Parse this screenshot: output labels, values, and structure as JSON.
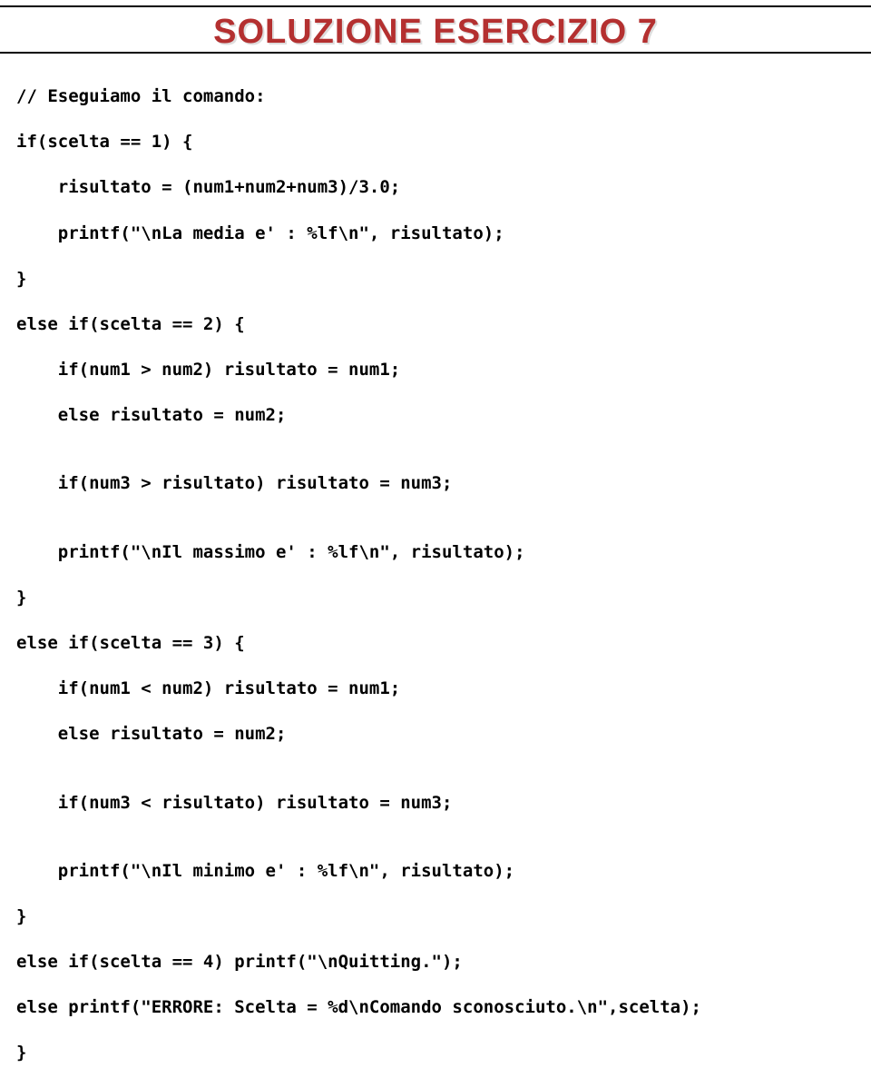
{
  "title": "SOLUZIONE ESERCIZIO 7",
  "code": {
    "l1": "// Eseguiamo il comando:",
    "l2": "if(scelta == 1) {",
    "l3": "    risultato = (num1+num2+num3)/3.0;",
    "l4": "    printf(\"\\nLa media e' : %lf\\n\", risultato);",
    "l5": "}",
    "l6": "else if(scelta == 2) {",
    "l7": "    if(num1 > num2) risultato = num1;",
    "l8": "    else risultato = num2;",
    "l9": "",
    "l10": "    if(num3 > risultato) risultato = num3;",
    "l11": "",
    "l12": "    printf(\"\\nIl massimo e' : %lf\\n\", risultato);",
    "l13": "}",
    "l14": "else if(scelta == 3) {",
    "l15": "    if(num1 < num2) risultato = num1;",
    "l16": "    else risultato = num2;",
    "l17": "",
    "l18": "    if(num3 < risultato) risultato = num3;",
    "l19": "",
    "l20": "    printf(\"\\nIl minimo e' : %lf\\n\", risultato);",
    "l21": "}",
    "l22": "else if(scelta == 4) printf(\"\\nQuitting.\");",
    "l23": "else printf(\"ERRORE: Scelta = %d\\nComando sconosciuto.\\n\",scelta);",
    "l24": "}"
  }
}
